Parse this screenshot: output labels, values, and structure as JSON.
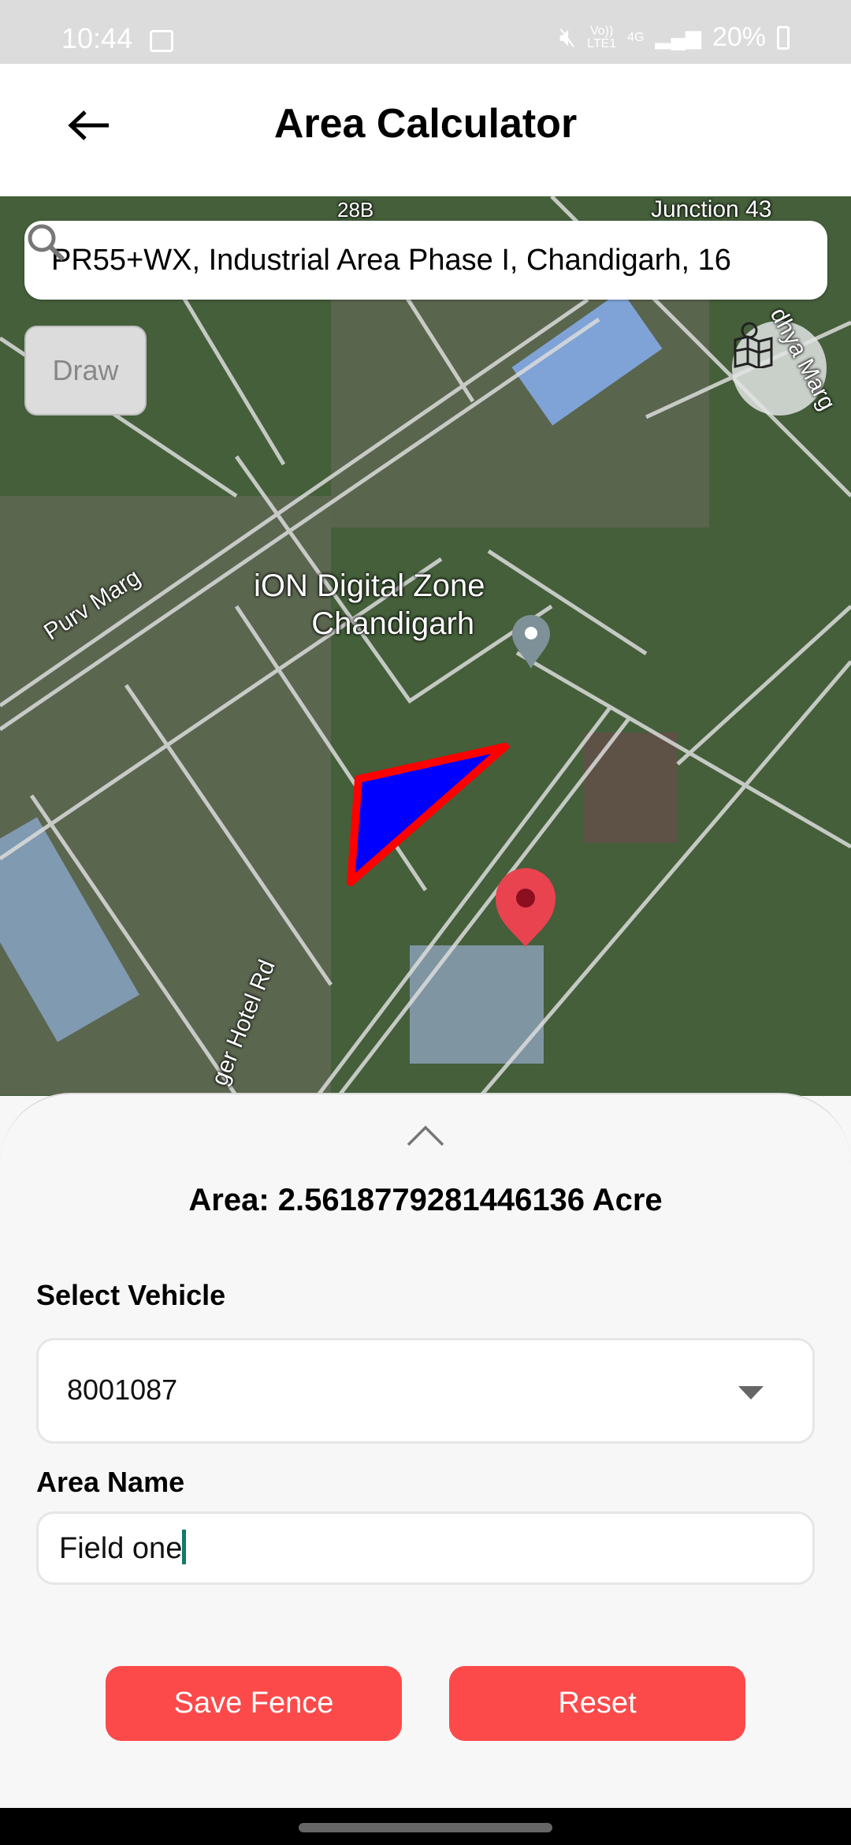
{
  "status_bar": {
    "time": "10:44",
    "network_top": "Vo))",
    "network_bottom": "LTE1",
    "network_type": "4G",
    "battery": "20%"
  },
  "header": {
    "title": "Area Calculator",
    "back_icon": "arrow-left-icon"
  },
  "map": {
    "search_value": "PR55+WX, Industrial Area Phase I, Chandigarh, 16",
    "draw_label": "Draw",
    "layers_icon": "map-layers-icon",
    "labels": {
      "junction": "Junction 43",
      "sector": "28B",
      "purv_marg": "Purv Marg",
      "poi_line1": "iON Digital Zone",
      "poi_line2": "Chandigarh",
      "hotel_rd": "ger Hotel Rd",
      "madhya_marg": "dhya Marg"
    },
    "polygon_fill": "#0000ff",
    "polygon_stroke": "#ff0000",
    "marker_color": "#e8434f"
  },
  "sheet": {
    "area_text": "Area: 2.5618779281446136 Acre",
    "vehicle_label": "Select Vehicle",
    "vehicle_value": "8001087",
    "area_name_label": "Area Name",
    "area_name_value": "Field one",
    "save_label": "Save Fence",
    "reset_label": "Reset",
    "accent": "#fc4a4a"
  }
}
